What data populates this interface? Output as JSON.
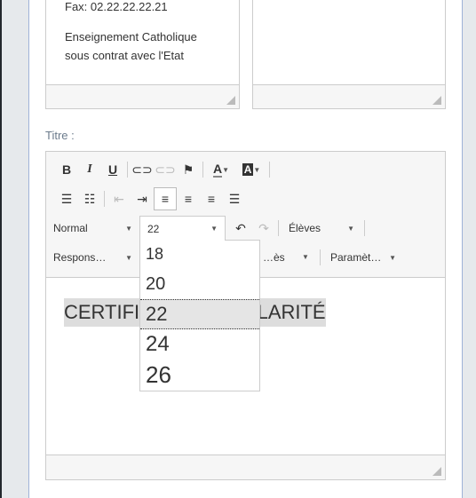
{
  "address": {
    "fax": "Fax: 02.22.22.22.21",
    "line1": "Enseignement Catholique",
    "line2": "sous contrat avec l'Etat"
  },
  "title_label": "Titre :",
  "toolbar": {
    "bold": "B",
    "italic": "I",
    "underline": "U",
    "text_color": "A",
    "bg_color": "A",
    "format": "Normal",
    "font_size": "22",
    "eleves": "Élèves",
    "respons": "Respons…",
    "hidden_combo": "…ès",
    "parametres": "Paramèt…"
  },
  "font_size_options": [
    {
      "label": "18",
      "size": 18
    },
    {
      "label": "20",
      "size": 20
    },
    {
      "label": "22",
      "size": 22,
      "selected": true
    },
    {
      "label": "24",
      "size": 24
    },
    {
      "label": "26",
      "size": 26
    }
  ],
  "content": {
    "title": "CERTIFICAT DE SCOLARITÉ"
  }
}
